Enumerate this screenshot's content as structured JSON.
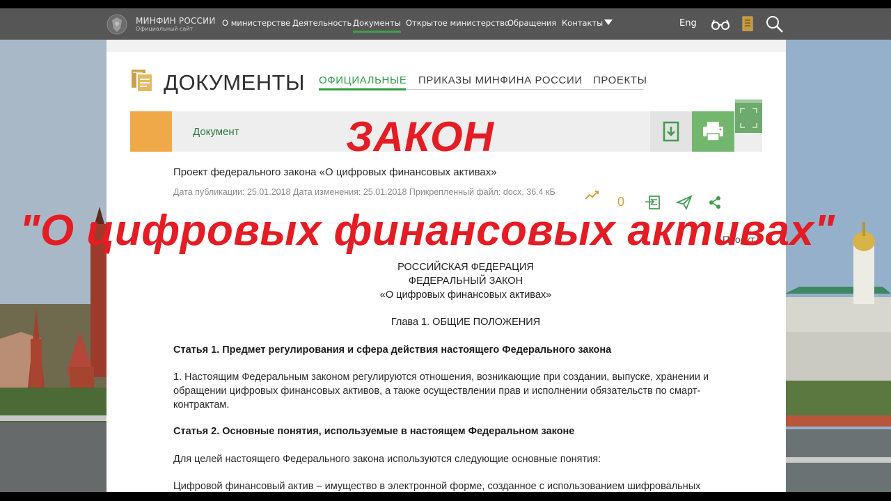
{
  "nav": {
    "logo_title": "МИНФИН РОССИИ",
    "logo_subtitle": "Официальный сайт",
    "items": [
      {
        "label": "О министерстве"
      },
      {
        "label": "Деятельность"
      },
      {
        "label": "Документы",
        "active": true
      },
      {
        "label": "Открытое министерство"
      },
      {
        "label": "Обращения"
      },
      {
        "label": "Контакты"
      }
    ],
    "language": "Eng",
    "icons": [
      "glasses-icon",
      "book-icon",
      "search-icon"
    ],
    "accent_color": "#3ea04c"
  },
  "section": {
    "title": "ДОКУМЕНТЫ",
    "tabs": [
      {
        "label": "ОФИЦИАЛЬНЫЕ",
        "active": true
      },
      {
        "label": "ПРИКАЗЫ МИНФИНА РОССИИ"
      },
      {
        "label": "ПРОЕКТЫ"
      }
    ]
  },
  "document_bar": {
    "label": "Документ",
    "swatch_color": "#efa948",
    "print_color": "#73b76f"
  },
  "document": {
    "title": "Проект федерального закона «О цифровых финансовых активах»",
    "meta": "Дата публикации:   25.01.2018 Дата изменения:   25.01.2018 Прикрепленный файл: docx, 36.4 кБ",
    "views": "0",
    "project_label": "Проект",
    "header_lines": [
      "РОССИЙСКАЯ ФЕДЕРАЦИЯ",
      "ФЕДЕРАЛЬНЫЙ ЗАКОН",
      "«О цифровых финансовых активах»"
    ],
    "chapter": "Глава 1. ОБЩИЕ ПОЛОЖЕНИЯ",
    "article1_title": "Статья 1. Предмет регулирования и сфера действия настоящего Федерального закона",
    "article1_text": "1. Настоящим Федеральным законом регулируются отношения, возникающие при создании, выпуске, хранении и обращении цифровых финансовых активов, а также осуществлении прав и исполнении обязательств по смарт-контрактам.",
    "article2_title": "Статья 2. Основные понятия, используемые в настоящем Федеральном законе",
    "article2_intro": "Для целей настоящего Федерального закона используются следующие основные понятия:",
    "article2_def": "Цифровой финансовый актив – имущество в электронной форме, созданное с использованием шифровальных"
  },
  "overlay": {
    "title": "ЗАКОН",
    "subtitle": "\"О цифровых финансовых активах\"",
    "color": "#e41c23"
  }
}
